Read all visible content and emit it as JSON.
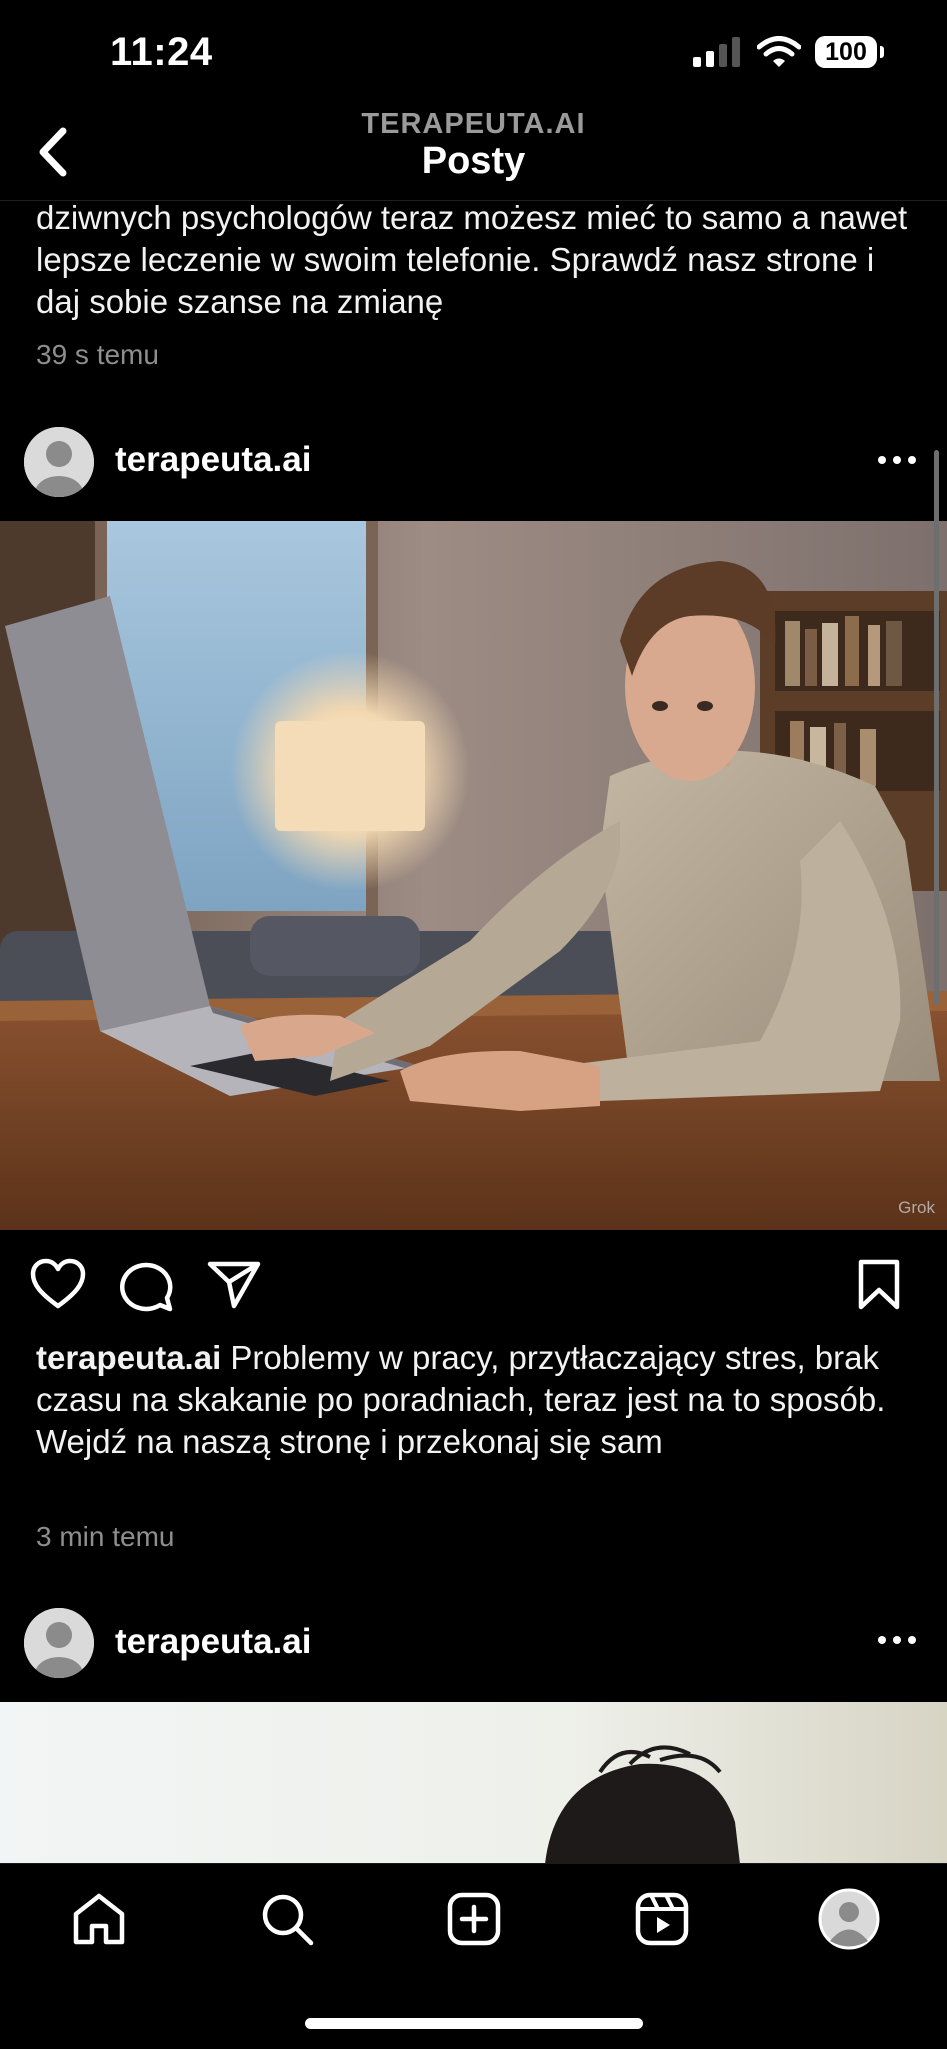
{
  "status_bar": {
    "time": "11:24",
    "battery": "100"
  },
  "header": {
    "account": "TERAPEUTA.AI",
    "title": "Posty"
  },
  "posts": [
    {
      "caption_text": "dziwnych psychologów teraz możesz mieć to samo a nawet lepsze leczenie w swoim telefonie. Sprawdź nasz strone i daj sobie szanse na zmianę",
      "time_ago": "39 s temu"
    },
    {
      "username": "terapeuta.ai",
      "image_watermark": "Grok",
      "caption_username": "terapeuta.ai",
      "caption_text": "Problemy w pracy, przytłaczający stres, brak czasu na skakanie po poradniach, teraz jest na to sposób. Wejdź na naszą stronę i przekonaj się sam",
      "time_ago": "3 min temu"
    },
    {
      "username": "terapeuta.ai"
    }
  ],
  "tab_bar": [
    "home-icon",
    "search-icon",
    "create-icon",
    "reels-icon",
    "profile-icon"
  ]
}
